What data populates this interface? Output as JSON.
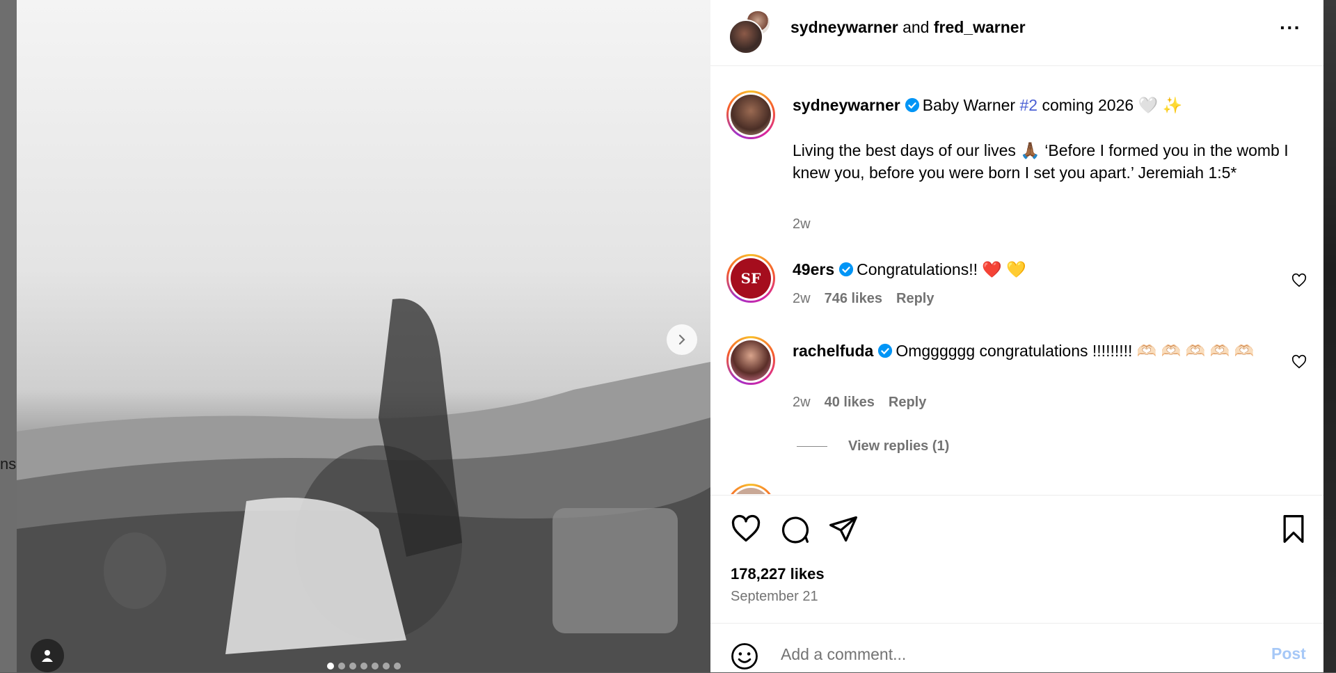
{
  "backdrop": {
    "left_text": "ns"
  },
  "carousel": {
    "dot_count": 7,
    "active_index": 0
  },
  "header": {
    "author1": "sydneywarner",
    "joiner": "and",
    "author2": "fred_warner",
    "more_label": "···"
  },
  "caption": {
    "username": "sydneywarner",
    "line1_pre": "Baby Warner ",
    "hashtag": "#2",
    "line1_post": " coming 2026 🤍 ✨",
    "body": "Living the best days of our lives 🙏🏾 ‘Before I formed you in the womb I knew you, before you were born I set you apart.’ Jeremiah 1:5*",
    "time": "2w"
  },
  "comments": [
    {
      "username": "49ers",
      "text": "Congratulations!! ❤️ 💛",
      "time": "2w",
      "likes": "746 likes",
      "reply": "Reply",
      "avatar_text": "SF"
    },
    {
      "username": "rachelfuda",
      "text": "Omgggggg congratulations !!!!!!!!! 🫶🏻 🫶🏻 🫶🏻 🫶🏻 🫶🏻",
      "time": "2w",
      "likes": "40 likes",
      "reply": "Reply",
      "view_replies": "View replies (1)"
    }
  ],
  "post_stats": {
    "likes": "178,227 likes",
    "date": "September 21"
  },
  "comment_box": {
    "placeholder": "Add a comment...",
    "post_label": "Post"
  },
  "colors": {
    "verified": "#0095f6",
    "link": "#4a5fd4",
    "post_disabled": "#a6c8f7",
    "secondary_text": "#737373"
  }
}
